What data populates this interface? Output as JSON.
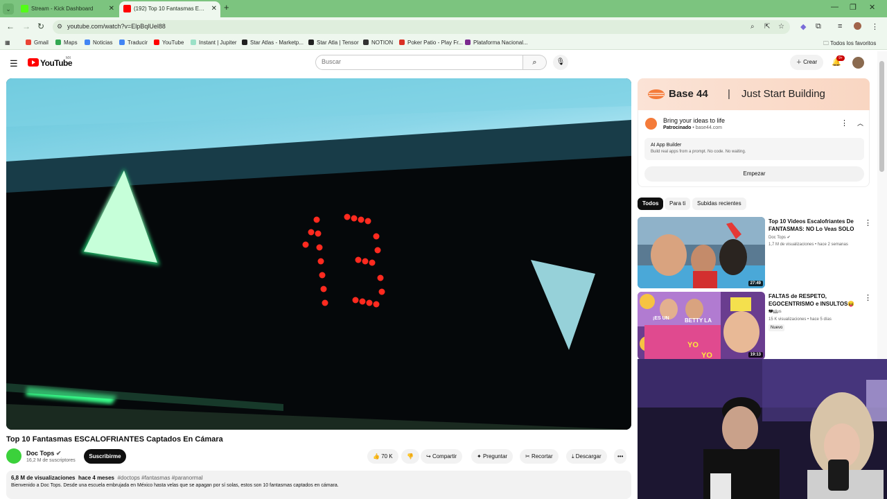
{
  "browser": {
    "tabs": [
      {
        "title": "Stream - Kick Dashboard",
        "favicon_color": "#53fc18",
        "active": false
      },
      {
        "title": "(192) Top 10 Fantasmas ESCALOFRIANTES",
        "favicon_color": "#ff0000",
        "active": true
      }
    ],
    "new_tab_icon": "plus-icon",
    "url": "youtube.com/watch?v=ElpBqlUel88",
    "bookmarks": [
      {
        "label": "Gmail",
        "color": "#ea4335"
      },
      {
        "label": "Maps",
        "color": "#34a853"
      },
      {
        "label": "Noticias",
        "color": "#4285f4"
      },
      {
        "label": "Traducir",
        "color": "#4285f4"
      },
      {
        "label": "YouTube",
        "color": "#ff0000"
      },
      {
        "label": "Instant | Jupiter",
        "color": "#9be1c7"
      },
      {
        "label": "Star Atlas - Marketp...",
        "color": "#222222"
      },
      {
        "label": "Star Atla | Tensor",
        "color": "#222222"
      },
      {
        "label": "NOTION",
        "color": "#333333"
      },
      {
        "label": "Poker Patio - Play Fr...",
        "color": "#d93025"
      },
      {
        "label": "Plataforma Nacional...",
        "color": "#7b2b8f"
      }
    ],
    "all_bookmarks": "Todos los favoritos"
  },
  "youtube": {
    "logo_text": "YouTube",
    "region": "MX",
    "search_placeholder": "Buscar",
    "create_label": "Crear",
    "notif_count": "9+"
  },
  "video": {
    "display_floor": "13",
    "title": "Top 10 Fantasmas ESCALOFRIANTES Captados En Cámara",
    "channel": "Doc Tops",
    "subscribers": "16,2 M de suscriptores",
    "subscribe_label": "Suscribirme",
    "likes": "70 K",
    "share_label": "Compartir",
    "ask_label": "Preguntar",
    "clip_label": "Recortar",
    "download_label": "Descargar",
    "views": "6,8 M de visualizaciones",
    "age": "hace 4 meses",
    "hashtags": "#doctops #fantasmas #paranormal",
    "description": "Bienvenido a Doc Tops.  Desde una escuela embrujada en México hasta velas que se apagan por sí solas, estos son 10 fantasmas captados en cámara."
  },
  "ad": {
    "brand": "Base 44",
    "separator": "|",
    "tagline": "Just Start Building",
    "headline": "Bring your ideas to life",
    "sponsored": "Patrocinado",
    "domain": "base44.com",
    "sub_title": "AI App Builder",
    "sub_desc": "Build real apps from a prompt. No code. No waiting.",
    "cta": "Empezar",
    "accent": "#f47b3a"
  },
  "filters": [
    {
      "label": "Todos",
      "selected": true
    },
    {
      "label": "Para ti",
      "selected": false
    },
    {
      "label": "Subidas recientes",
      "selected": false
    }
  ],
  "recommendations": [
    {
      "title": "Top 10 Videos Escalofriantes De FANTASMAS: NO Lo Veas SOLO",
      "channel": "Doc Tops",
      "stats": "1,7 M de visualizaciones • hace 2 semanas",
      "duration": "27:49"
    },
    {
      "title": "FALTAS de RESPETO, EGOCENTRISMO e INSULTOS😝 ❤...",
      "channel": "Joelius",
      "stats": "15 K visualizaciones • hace 5 días",
      "badge": "Nuevo",
      "duration": "19:13",
      "thumb_texts": [
        "¡ES UN",
        "BETTY LA",
        "YO",
        "YO"
      ]
    }
  ]
}
